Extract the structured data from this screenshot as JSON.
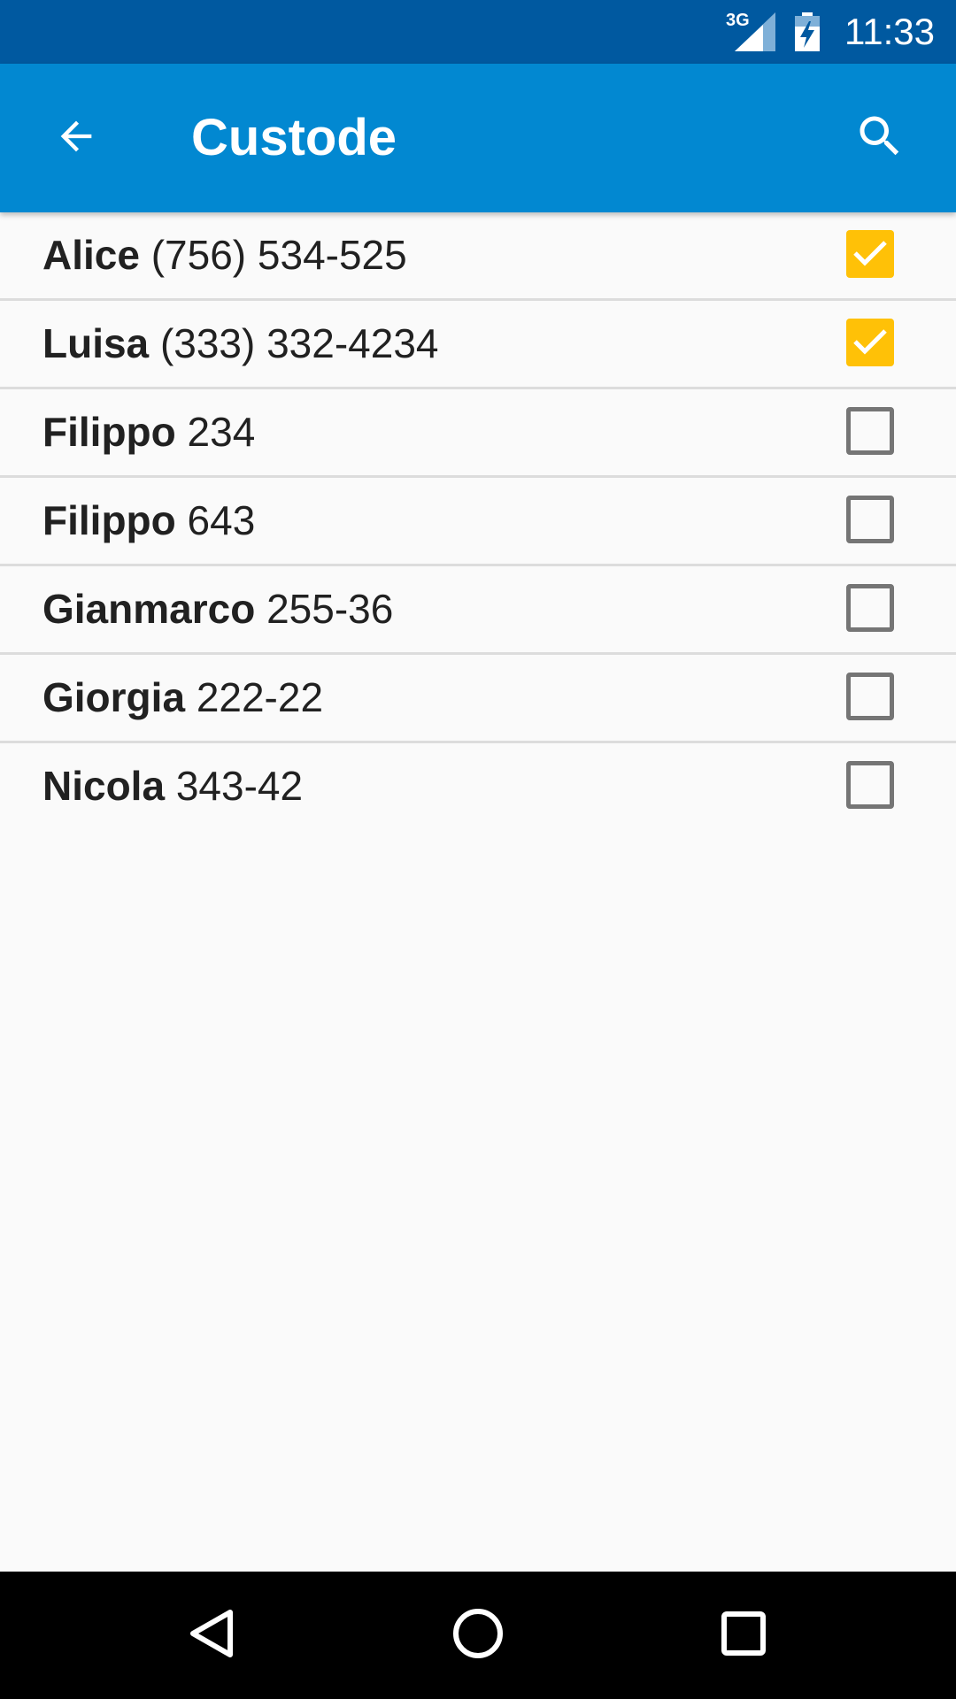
{
  "status_bar": {
    "network_type": "3G",
    "time": "11:33",
    "background_color": "#0059a0",
    "signal_icon": "cell-signal-icon",
    "battery_icon": "battery-charging-icon"
  },
  "app_bar": {
    "title": "Custode",
    "background_color": "#0288d1",
    "back_icon": "arrow-back-icon",
    "search_icon": "search-icon"
  },
  "contacts": [
    {
      "name": "Alice",
      "number": "(756) 534-525",
      "checked": true
    },
    {
      "name": "Luisa",
      "number": "(333) 332-4234",
      "checked": true
    },
    {
      "name": "Filippo",
      "number": "234",
      "checked": false
    },
    {
      "name": "Filippo",
      "number": "643",
      "checked": false
    },
    {
      "name": "Gianmarco",
      "number": "255-36",
      "checked": false
    },
    {
      "name": "Giorgia",
      "number": "222-22",
      "checked": false
    },
    {
      "name": "Nicola",
      "number": "343-42",
      "checked": false
    }
  ],
  "checkbox_checked_color": "#ffc107",
  "nav_bar": {
    "back_icon": "nav-back-icon",
    "home_icon": "nav-home-icon",
    "recents_icon": "nav-recents-icon"
  }
}
